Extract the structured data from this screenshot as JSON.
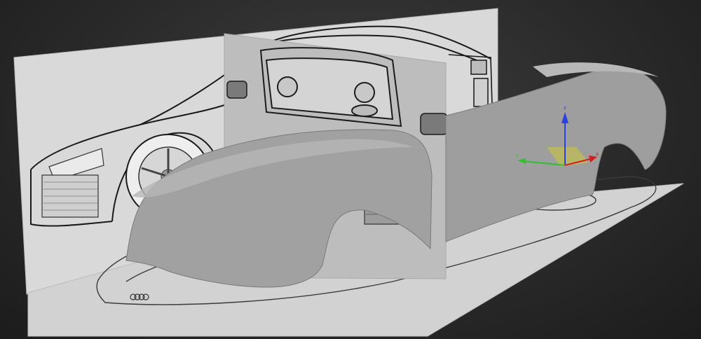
{
  "viewport": {
    "name": "3d-viewport",
    "background": "#2c2c2c"
  },
  "reference_planes": {
    "side_plane_color": "#d9d9d9",
    "front_plane_color": "#bdbdbd",
    "floor_plane_color": "#d2d2d2"
  },
  "model": {
    "surface_color": "#9c9c9c",
    "surface_highlight": "#b4b4b4"
  },
  "gizmo": {
    "axis_x_label": "x",
    "axis_y_label": "y",
    "axis_z_label": "z",
    "axis_x_color": "#d22020",
    "axis_y_color": "#2fbf2f",
    "axis_z_color": "#2a40e0",
    "plane_color": "#e8e000"
  },
  "brand_mark": {
    "type": "four-rings-logo"
  }
}
